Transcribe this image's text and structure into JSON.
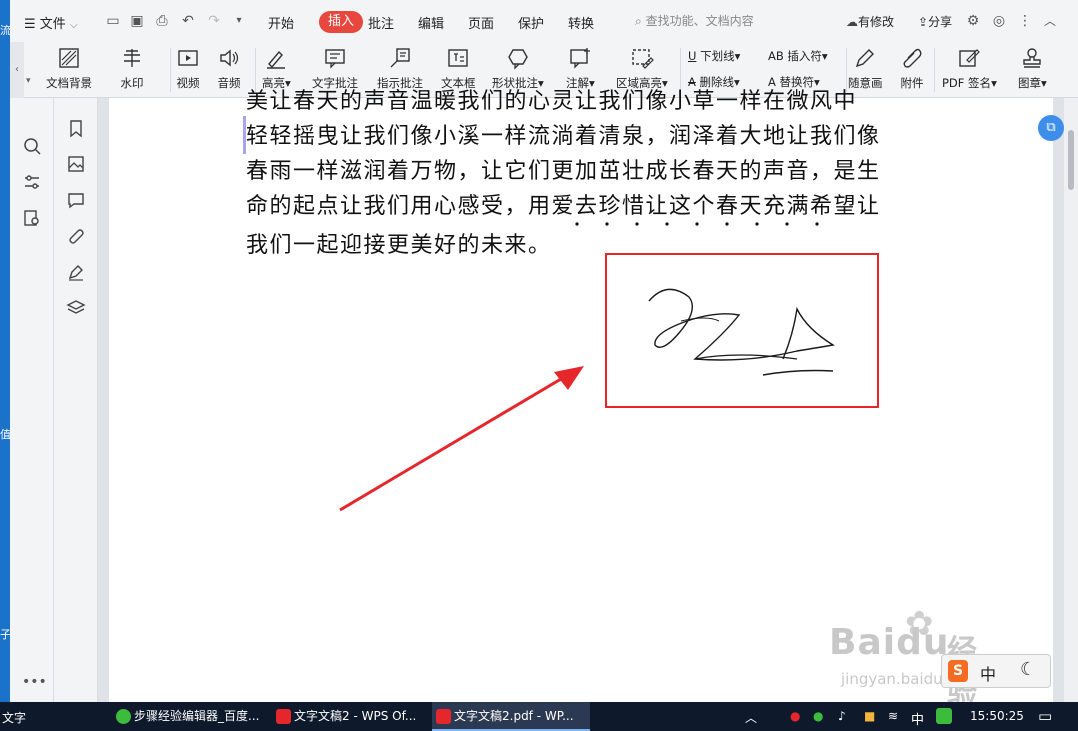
{
  "menu": {
    "file_label": "文件",
    "tabs": [
      "开始",
      "插入",
      "批注",
      "编辑",
      "页面",
      "保护",
      "转换"
    ],
    "active_tab": "插入",
    "search_placeholder": "查找功能、文档内容",
    "changes_label": "有修改",
    "share_label": "分享"
  },
  "ribbon": {
    "buttons": [
      "文档背景",
      "水印",
      "视频",
      "音频",
      "高亮",
      "文字批注",
      "指示批注",
      "文本框",
      "形状批注",
      "注解",
      "区域高亮"
    ],
    "small": [
      "下划线",
      "删除线",
      "插入符",
      "替换符"
    ],
    "right_buttons": [
      "随意画",
      "附件",
      "PDF 签名",
      "图章"
    ]
  },
  "document": {
    "lines": [
      "美让春天的声音温暖我们的心灵让我们像小草一样在微风中",
      "轻轻摇曳让我们像小溪一样流淌着清泉，润泽着大地让我们像",
      "春雨一样滋润着万物，让它们更加茁壮成长春天的声音，是生",
      "命的起点让我们用心感受，用爱去珍惜让这个春天充满希望让",
      "我们一起迎接更美好的未来。"
    ]
  },
  "watermark": {
    "brand": "Baidu",
    "brand_cn": "经验",
    "url": "jingyan.baidu.com"
  },
  "ime": {
    "label": "中"
  },
  "desktop_fragments": [
    "流",
    "子",
    "值",
    "文字"
  ],
  "taskbar": {
    "start_fragment": "文字",
    "tasks": [
      {
        "label": "步骤经验编辑器_百度...",
        "color": "#3dbb3d"
      },
      {
        "label": "文字文稿2 - WPS Of...",
        "color": "#e5262b"
      },
      {
        "label": "文字文稿2.pdf - WP...",
        "color": "#e5262b"
      }
    ],
    "active_task_index": 2,
    "ime_tray": "中",
    "clock": "15:50:25"
  },
  "colors": {
    "accent": "#e7473c",
    "annotation_box": "#e5262b",
    "arrow": "#e5262b"
  }
}
